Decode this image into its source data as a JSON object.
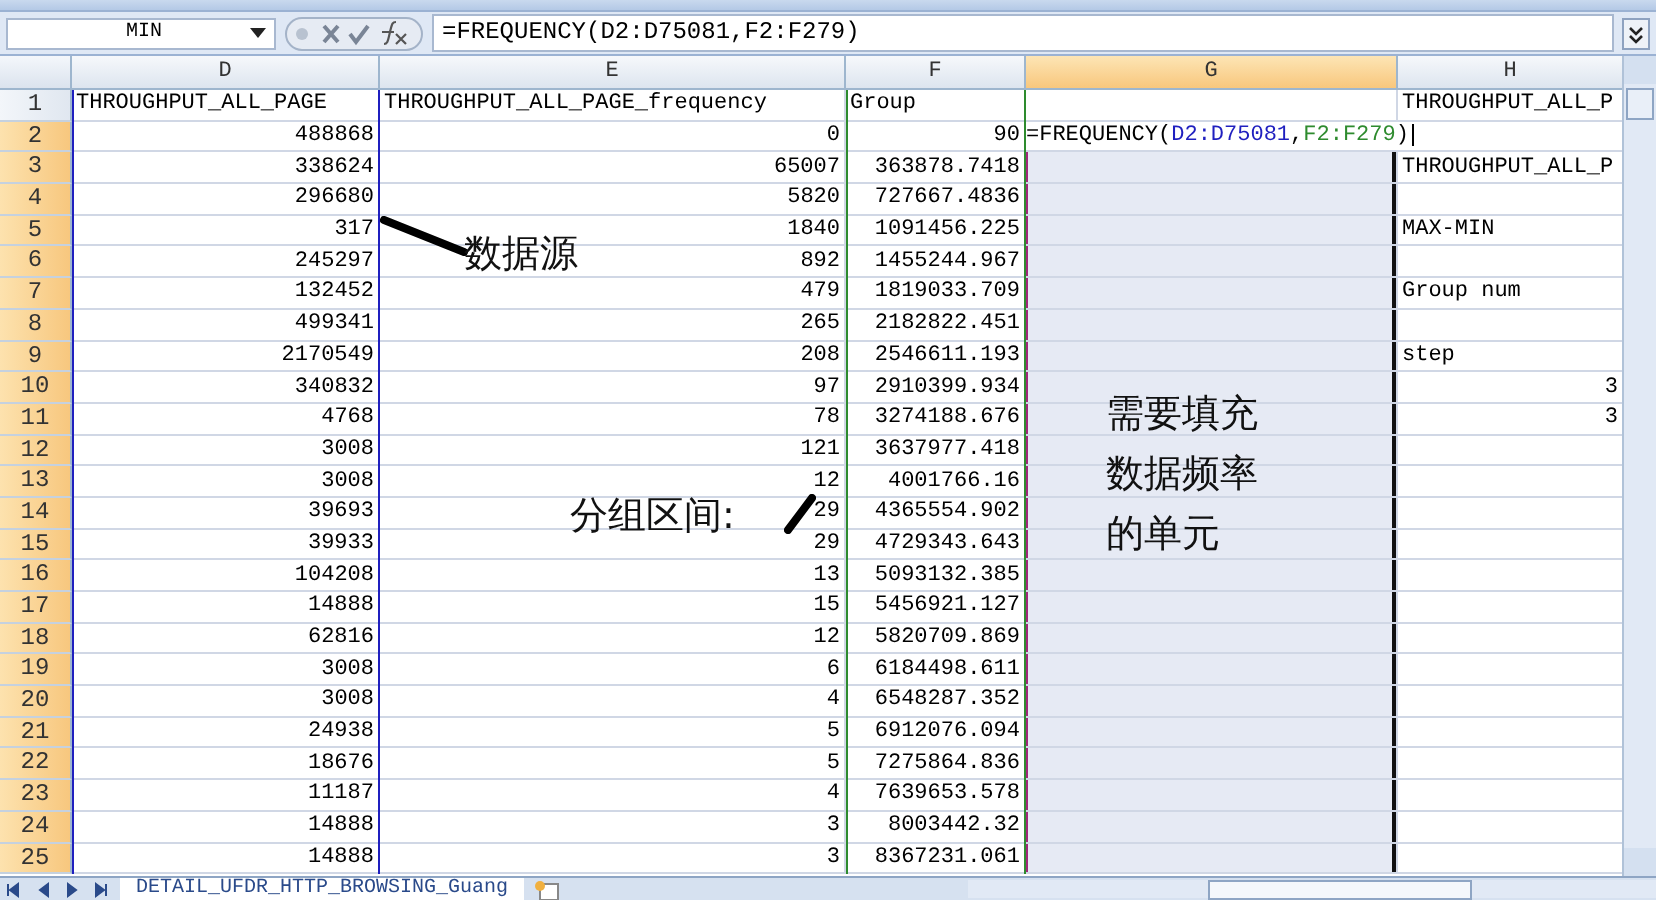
{
  "formula_bar": {
    "name_box": "MIN",
    "formula": "=FREQUENCY(D2:D75081,F2:F279)"
  },
  "columns": [
    {
      "label": "D",
      "selected": false,
      "color": "#1f1fbf"
    },
    {
      "label": "E",
      "selected": false
    },
    {
      "label": "F",
      "selected": false,
      "color": "#2e8b2e"
    },
    {
      "label": "G",
      "selected": true
    },
    {
      "label": "H",
      "selected": false
    }
  ],
  "rows": [
    {
      "row": "1",
      "selected": false,
      "D": "THROUGHPUT_ALL_PAGE",
      "E": "THROUGHPUT_ALL_PAGE_frequency",
      "F": "Group",
      "H": "THROUGHPUT_ALL_P"
    },
    {
      "row": "2",
      "selected": true,
      "D": "488868",
      "E": "0",
      "F": "90",
      "G": [
        {
          "text": "=FREQUENCY(",
          "color": "#000000"
        },
        {
          "text": "D2:D75081",
          "color": "#1f1fbf"
        },
        {
          "text": ",",
          "color": "#000000"
        },
        {
          "text": "F2:F279",
          "color": "#2e8b2e"
        },
        {
          "text": ")",
          "color": "#000000"
        }
      ]
    },
    {
      "row": "3",
      "selected": true,
      "D": "338624",
      "E": "65007",
      "F": "363878.7418",
      "H": "THROUGHPUT_ALL_P"
    },
    {
      "row": "4",
      "selected": true,
      "D": "296680",
      "E": "5820",
      "F": "727667.4836"
    },
    {
      "row": "5",
      "selected": true,
      "D": "317",
      "E": "1840",
      "F": "1091456.225",
      "H": "MAX-MIN"
    },
    {
      "row": "6",
      "selected": true,
      "D": "245297",
      "E": "892",
      "F": "1455244.967"
    },
    {
      "row": "7",
      "selected": true,
      "D": "132452",
      "E": "479",
      "F": "1819033.709",
      "H": "Group num"
    },
    {
      "row": "8",
      "selected": true,
      "D": "499341",
      "E": "265",
      "F": "2182822.451"
    },
    {
      "row": "9",
      "selected": true,
      "D": "2170549",
      "E": "208",
      "F": "2546611.193",
      "H": "step"
    },
    {
      "row": "10",
      "selected": true,
      "D": "340832",
      "E": "97",
      "F": "2910399.934",
      "H": "3"
    },
    {
      "row": "11",
      "selected": true,
      "D": "4768",
      "E": "78",
      "F": "3274188.676",
      "H": "3"
    },
    {
      "row": "12",
      "selected": true,
      "D": "3008",
      "E": "121",
      "F": "3637977.418"
    },
    {
      "row": "13",
      "selected": true,
      "D": "3008",
      "E": "12",
      "F": "4001766.16"
    },
    {
      "row": "14",
      "selected": true,
      "D": "39693",
      "E": "29",
      "F": "4365554.902"
    },
    {
      "row": "15",
      "selected": true,
      "D": "39933",
      "E": "29",
      "F": "4729343.643"
    },
    {
      "row": "16",
      "selected": true,
      "D": "104208",
      "E": "13",
      "F": "5093132.385"
    },
    {
      "row": "17",
      "selected": true,
      "D": "14888",
      "E": "15",
      "F": "5456921.127"
    },
    {
      "row": "18",
      "selected": true,
      "D": "62816",
      "E": "12",
      "F": "5820709.869"
    },
    {
      "row": "19",
      "selected": true,
      "D": "3008",
      "E": "6",
      "F": "6184498.611"
    },
    {
      "row": "20",
      "selected": true,
      "D": "3008",
      "E": "4",
      "F": "6548287.352"
    },
    {
      "row": "21",
      "selected": true,
      "D": "24938",
      "E": "5",
      "F": "6912076.094"
    },
    {
      "row": "22",
      "selected": true,
      "D": "18676",
      "E": "5",
      "F": "7275864.836"
    },
    {
      "row": "23",
      "selected": true,
      "D": "11187",
      "E": "4",
      "F": "7639653.578"
    },
    {
      "row": "24",
      "selected": true,
      "D": "14888",
      "E": "3",
      "F": "8003442.32"
    },
    {
      "row": "25",
      "selected": true,
      "D": "14888",
      "E": "3",
      "F": "8367231.061"
    }
  ],
  "annotations": [
    {
      "text": "数据源"
    },
    {
      "text": "分组区间:"
    },
    {
      "text": "需要填充数据频率的单元"
    }
  ],
  "sheet_tabs": [
    {
      "label": "DETAIL_UFDR_HTTP_BROWSING_Guang",
      "selected": true
    }
  ]
}
